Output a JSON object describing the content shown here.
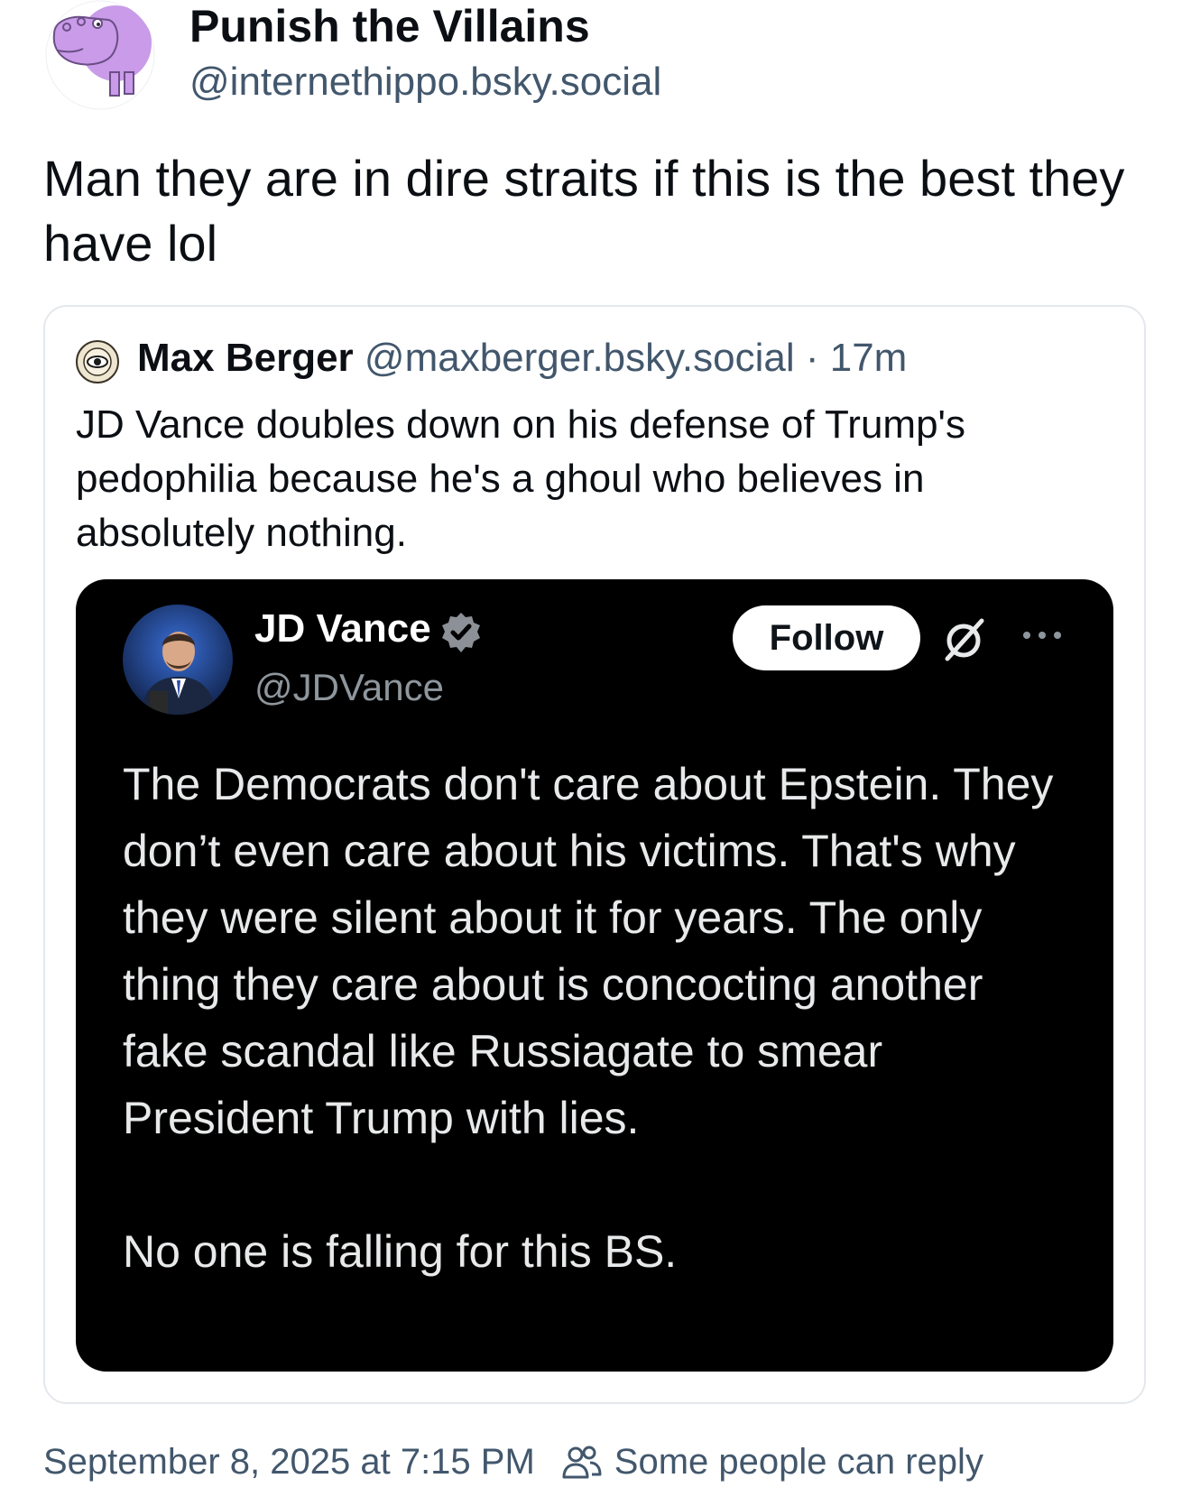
{
  "post": {
    "author_name": "Punish the Villains",
    "author_handle": "@internethippo.bsky.social",
    "avatar_icon": "hippo-avatar-icon",
    "text": "Man they are in dire straits if this is the best they have lol",
    "timestamp": "September 8, 2025 at 7:15 PM",
    "reply_setting": "Some people can reply"
  },
  "quote": {
    "author_name": "Max Berger",
    "author_handle": "@maxberger.bsky.social",
    "separator": "·",
    "time": "17m",
    "text": "JD Vance doubles down on his defense of Trump's pedophilia because he's a ghoul who believes in absolutely nothing."
  },
  "embed": {
    "name": "JD Vance",
    "handle": "@JDVance",
    "follow_label": "Follow",
    "paragraph_1": "The Democrats don't care about Epstein. They don’t even care about his victims. That's why they were silent about it for years. The only thing they care about is concocting another fake scandal like Russiagate to smear President Trump with lies.",
    "paragraph_2": "No one is falling for this BS."
  },
  "colors": {
    "text_primary": "#0b0f14",
    "text_secondary": "#42576c",
    "card_border": "#e4e8ec",
    "embed_bg": "#000000",
    "avatar_purple": "#c99be8"
  }
}
